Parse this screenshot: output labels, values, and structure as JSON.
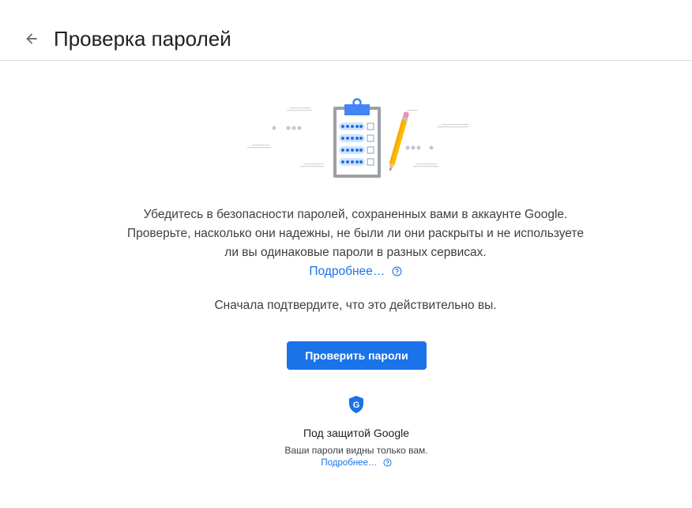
{
  "header": {
    "title": "Проверка паролей",
    "back_icon": "arrow-back-icon"
  },
  "intro": {
    "text": "Убедитесь в безопасности паролей, сохраненных вами в аккаунте Google. Проверьте, насколько они надежны, не были ли они раскрыты и не используете ли вы одинаковые пароли в разных сервисах.",
    "learn_more": "Подробнее…",
    "help_icon": "help-circle-icon"
  },
  "confirm": {
    "text": "Сначала подтвердите, что это действительно вы."
  },
  "action": {
    "check_button": "Проверить пароли"
  },
  "protection": {
    "icon": "google-shield-icon",
    "shield_letter": "G",
    "title": "Под защитой Google",
    "subtitle": "Ваши пароли видны только вам.",
    "learn_more": "Подробнее…",
    "help_icon": "help-circle-icon"
  },
  "colors": {
    "accent": "#1a73e8",
    "text": "#202124",
    "secondary_text": "#3c4043",
    "divider": "#dadce0",
    "pencil": "#fbbc04",
    "eraser": "#f48fb1"
  }
}
